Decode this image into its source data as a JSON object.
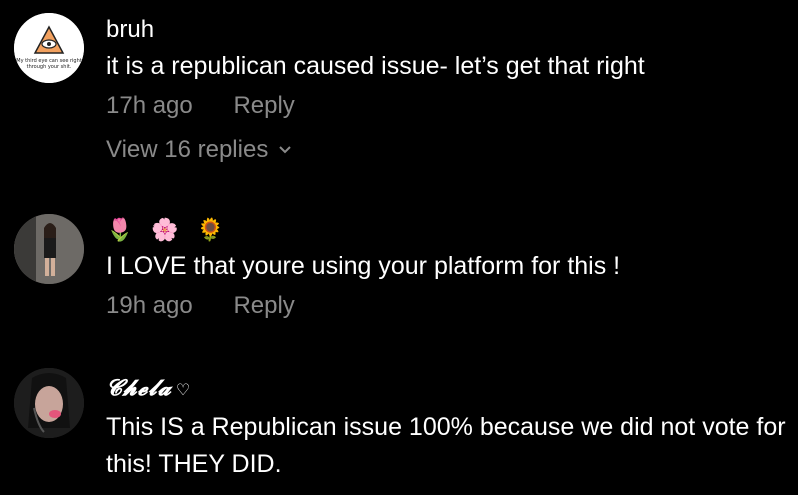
{
  "comments": [
    {
      "username": "bruh",
      "text": "it is a republican caused issue- let’s get that right",
      "time": "17h ago",
      "reply_label": "Reply",
      "view_replies": "View 16 replies",
      "avatar_text_1": "My third eye can see right",
      "avatar_text_2": "through your shit."
    },
    {
      "emojis": [
        "🌷",
        "🌸",
        "🌻"
      ],
      "text": "I LOVE that youre using your platform for this !",
      "time": "19h ago",
      "reply_label": "Reply"
    },
    {
      "username": "𝓒𝓱𝓮𝓵𝓪",
      "heart": "♡",
      "text": "This IS a Republican issue 100% because we did not vote for this! THEY DID."
    }
  ],
  "colors": {
    "background": "#000000",
    "text": "#ffffff",
    "muted": "#8a8a8a"
  }
}
